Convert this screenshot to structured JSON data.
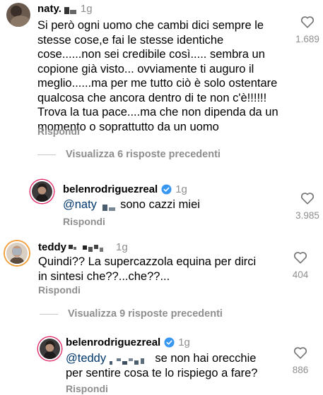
{
  "comments": [
    {
      "username": "naty.",
      "time": "1g",
      "text": "Si però ogni uomo che cambi dici sempre le stesse cose,e fai le stesse identiche cose......non sei credibile così..... sembra un copione già visto... ovviamente ti auguro il meglio......ma per me tutto ciò è solo ostentare qualcosa che ancora dentro di te non c'è!!!!!! Trova la tua pace....ma che non dipenda da un momento o soprattutto da un uomo",
      "reply_label": "Rispondi",
      "like_count": "1.689",
      "view_more": "Visualizza 6 risposte precedenti"
    },
    {
      "username": "belenrodriguezreal",
      "time": "1g",
      "mention": "@naty",
      "text": "sono cazzi miei",
      "reply_label": "Rispondi",
      "like_count": "3.985"
    },
    {
      "username": "teddy",
      "time": "1g",
      "text": "Quindi?? La supercazzola equina per dirci in sintesi che??...che??...",
      "reply_label": "Rispondi",
      "like_count": "404",
      "view_more": "Visualizza 9 risposte precedenti"
    },
    {
      "username": "belenrodriguezreal",
      "time": "1g",
      "mention": "@teddy",
      "text": "se non hai orecchie per sentire cosa te lo rispiego a fare?",
      "reply_label": "Rispondi",
      "like_count": "886"
    }
  ]
}
